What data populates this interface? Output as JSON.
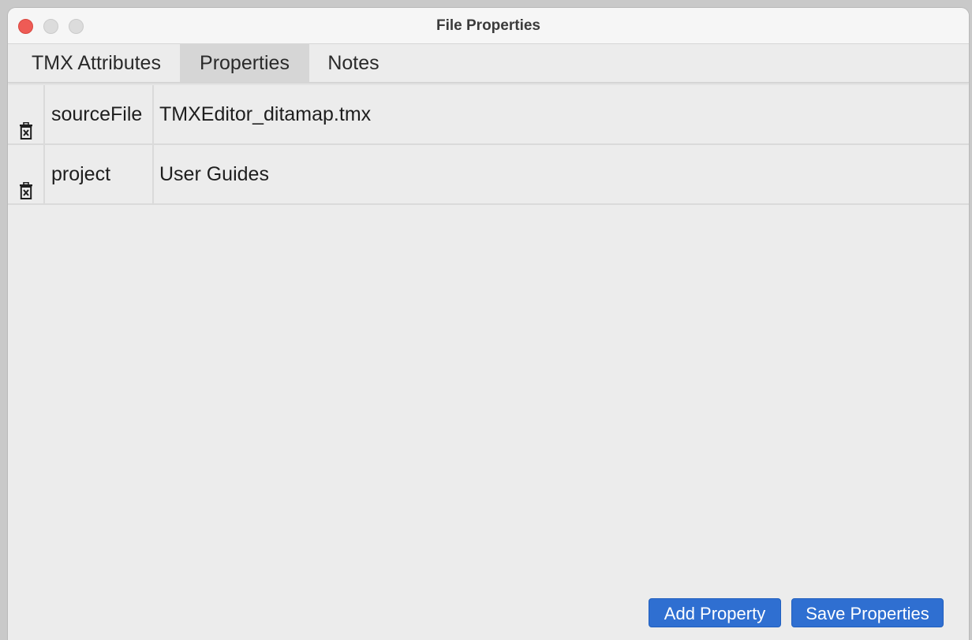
{
  "window": {
    "title": "File Properties"
  },
  "tabs": [
    {
      "label": "TMX Attributes",
      "active": false
    },
    {
      "label": "Properties",
      "active": true
    },
    {
      "label": "Notes",
      "active": false
    }
  ],
  "properties": [
    {
      "name": "sourceFile",
      "value": "TMXEditor_ditamap.tmx"
    },
    {
      "name": "project",
      "value": "User Guides"
    }
  ],
  "buttons": {
    "add_property": "Add Property",
    "save_properties": "Save Properties"
  },
  "icons": {
    "delete": "trash-icon"
  },
  "colors": {
    "accent": "#2f6fd1",
    "close": "#ee5b55",
    "active_tab": "#d6d6d6"
  }
}
